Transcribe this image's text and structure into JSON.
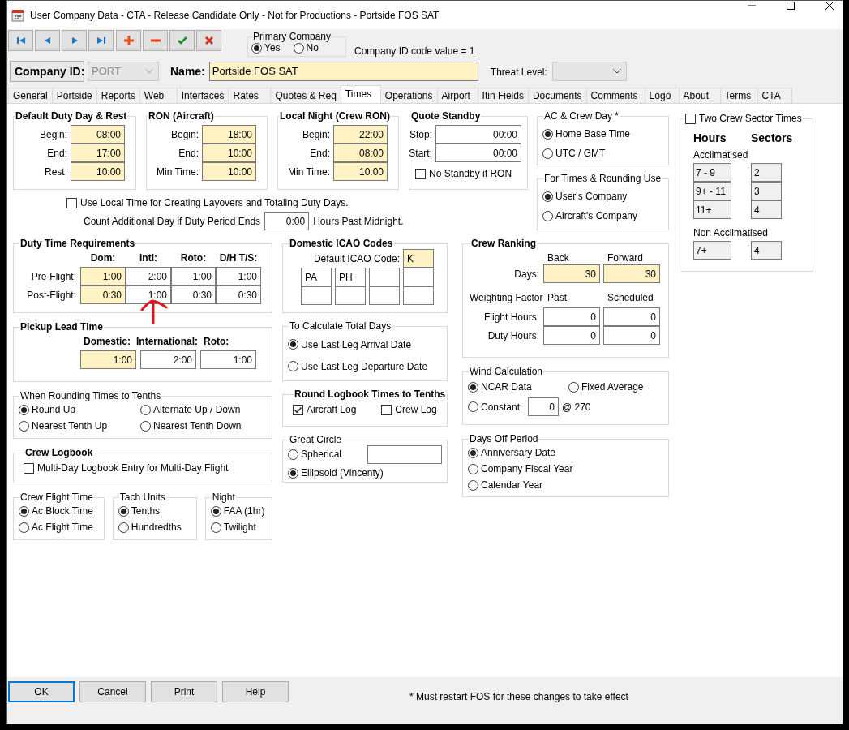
{
  "window": {
    "title": "User Company Data - CTA - Release Candidate Only - Not for Productions - Portside FOS SAT"
  },
  "primary_company": {
    "title": "Primary Company",
    "options": [
      {
        "label": "Yes",
        "selected": true
      },
      {
        "label": "No",
        "selected": false
      }
    ]
  },
  "company_id_code": "Company ID code value = 1",
  "company_id": {
    "label": "Company ID:",
    "value": "PORT",
    "disabled": true
  },
  "name": {
    "label": "Name:",
    "value": "Portside FOS SAT",
    "highlighted": true
  },
  "threat_level": {
    "label": "Threat Level:"
  },
  "tabs": [
    {
      "label": "General",
      "selected": false
    },
    {
      "label": "Portside",
      "selected": false
    },
    {
      "label": "Reports",
      "selected": false
    },
    {
      "label": "Web",
      "selected": false
    },
    {
      "label": "Interfaces",
      "selected": false
    },
    {
      "label": "Rates",
      "selected": false
    },
    {
      "label": "Quotes & Req",
      "selected": false
    },
    {
      "label": "Times",
      "selected": true
    },
    {
      "label": "Operations",
      "selected": false
    },
    {
      "label": "Airport",
      "selected": false
    },
    {
      "label": "Itin Fields",
      "selected": false
    },
    {
      "label": "Documents",
      "selected": false
    },
    {
      "label": "Comments",
      "selected": false
    },
    {
      "label": "Logo",
      "selected": false
    },
    {
      "label": "About",
      "selected": false
    },
    {
      "label": "Terms",
      "selected": false
    },
    {
      "label": "CTA",
      "selected": false
    }
  ],
  "time_groups": [
    {
      "title": "Default Duty Day & Rest",
      "bold": true,
      "rows": [
        {
          "label": "Begin:",
          "field": {
            "value": "08:00",
            "highlighted": true
          }
        },
        {
          "label": "End:",
          "field": {
            "value": "17:00",
            "highlighted": true
          }
        },
        {
          "label": "Rest:",
          "field": {
            "value": "10:00",
            "highlighted": true
          }
        }
      ]
    },
    {
      "title": "RON (Aircraft)",
      "bold": true,
      "rows": [
        {
          "label": "Begin:",
          "field": {
            "value": "18:00",
            "highlighted": true
          }
        },
        {
          "label": "End:",
          "field": {
            "value": "10:00",
            "highlighted": true
          }
        },
        {
          "label": "Min Time:",
          "field": {
            "value": "10:00",
            "highlighted": true
          }
        }
      ]
    },
    {
      "title": "Local Night (Crew RON)",
      "bold": true,
      "rows": [
        {
          "label": "Begin:",
          "field": {
            "value": "22:00",
            "highlighted": true
          }
        },
        {
          "label": "End:",
          "field": {
            "value": "08:00",
            "highlighted": true
          }
        },
        {
          "label": "Min Time:",
          "field": {
            "value": "10:00",
            "highlighted": true
          }
        }
      ]
    },
    {
      "title": "Quote Standby",
      "bold": true,
      "rows": [
        {
          "label": "Stop:",
          "field": {
            "value": "00:00",
            "highlighted": false
          }
        },
        {
          "label": "Start:",
          "field": {
            "value": "00:00",
            "highlighted": false
          }
        }
      ],
      "checkbox": {
        "label": "No Standby if RON",
        "checked": false
      }
    }
  ],
  "ac_crew_day": {
    "title": "AC & Crew Day *",
    "bold": false,
    "options": [
      {
        "label": "Home Base Time",
        "selected": true
      },
      {
        "label": "UTC / GMT",
        "selected": false
      }
    ]
  },
  "times_rounding_use": {
    "title": "For Times & Rounding Use",
    "bold": false,
    "options": [
      {
        "label": "User's Company",
        "selected": true
      },
      {
        "label": "Aircraft's Company",
        "selected": false
      }
    ]
  },
  "use_local_time": {
    "label": "Use Local Time for Creating Layovers and Totaling Duty Days.",
    "checked": false
  },
  "count_additional_day": {
    "label": "Count Additional Day if Duty Period Ends",
    "field": {
      "value": "0:00",
      "highlighted": false
    },
    "suffix": "Hours Past Midnight."
  },
  "duty_time_requirements": {
    "title": "Duty Time Requirements",
    "bold": true,
    "columns": [
      "Dom:",
      "Intl:",
      "Roto:",
      "D/H T/S:"
    ],
    "rows": [
      {
        "label": "Pre-Flight:",
        "cells": [
          {
            "value": "1:00",
            "highlighted": true
          },
          {
            "value": "2:00",
            "highlighted": false
          },
          {
            "value": "1:00",
            "highlighted": false
          },
          {
            "value": "1:00",
            "highlighted": false
          }
        ]
      },
      {
        "label": "Post-Flight:",
        "cells": [
          {
            "value": "0:30",
            "highlighted": true
          },
          {
            "value": "1:00",
            "highlighted": false
          },
          {
            "value": "0:30",
            "highlighted": false
          },
          {
            "value": "0:30",
            "highlighted": false
          }
        ]
      }
    ]
  },
  "domestic_icao_codes": {
    "title": "Domestic ICAO Codes",
    "bold": true,
    "default_label": "Default ICAO Code:",
    "default_field": {
      "value": "K",
      "highlighted": true
    },
    "codes": [
      [
        {
          "value": "PA",
          "highlighted": false
        },
        {
          "value": "PH",
          "highlighted": false
        },
        {
          "highlighted": false
        },
        {
          "highlighted": false
        }
      ],
      [
        {
          "highlighted": false
        },
        {
          "highlighted": false
        },
        {
          "highlighted": false
        },
        {
          "highlighted": false
        }
      ]
    ]
  },
  "pickup_lead_time": {
    "title": "Pickup Lead Time",
    "bold": true,
    "columns": [
      "Domestic:",
      "International:",
      "Roto:"
    ],
    "fields": [
      {
        "value": "1:00",
        "highlighted": true
      },
      {
        "value": "2:00",
        "highlighted": false
      },
      {
        "value": "1:00",
        "highlighted": false
      }
    ]
  },
  "to_calculate_total_days": {
    "title": "To Calculate Total Days",
    "bold": false,
    "options": [
      {
        "label": "Use Last Leg Arrival Date",
        "selected": true
      },
      {
        "label": "Use Last Leg Departure Date",
        "selected": false
      }
    ]
  },
  "rounding_times": {
    "title": "When Rounding Times to Tenths",
    "bold": false,
    "options": [
      {
        "label": "Round Up",
        "selected": true
      },
      {
        "label": "Alternate Up / Down",
        "selected": false
      },
      {
        "label": "Nearest Tenth Up",
        "selected": false
      },
      {
        "label": "Nearest Tenth Down",
        "selected": false
      }
    ]
  },
  "round_logbook_times": {
    "title": "Round Logbook Times to Tenths",
    "bold": true,
    "checkboxes": [
      {
        "label": "Aircraft Log",
        "checked": true
      },
      {
        "label": "Crew Log",
        "checked": false
      }
    ]
  },
  "crew_logbook": {
    "title": "Crew Logbook",
    "bold": true,
    "checkbox": {
      "label": "Multi-Day Logbook Entry for Multi-Day Flight",
      "checked": false
    }
  },
  "great_circle": {
    "title": "Great Circle",
    "bold": false,
    "options": [
      {
        "label": "Spherical",
        "selected": false
      },
      {
        "label": "Ellipsoid (Vincenty)",
        "selected": true
      }
    ],
    "field": {
      "highlighted": false
    }
  },
  "small_groups": [
    {
      "title": "Crew Flight Time",
      "bold": false,
      "options": [
        {
          "label": "Ac Block Time",
          "selected": true
        },
        {
          "label": "Ac Flight Time",
          "selected": false
        }
      ]
    },
    {
      "title": "Tach Units",
      "bold": false,
      "options": [
        {
          "label": "Tenths",
          "selected": true
        },
        {
          "label": "Hundredths",
          "selected": false
        }
      ]
    },
    {
      "title": "Night",
      "bold": false,
      "options": [
        {
          "label": "FAA (1hr)",
          "selected": true
        },
        {
          "label": "Twilight",
          "selected": false
        }
      ]
    }
  ],
  "crew_ranking": {
    "title": "Crew Ranking",
    "bold": true,
    "columns": [
      "Back",
      "Forward"
    ],
    "days": {
      "label": "Days:",
      "fields": [
        {
          "value": "30",
          "highlighted": true
        },
        {
          "value": "30",
          "highlighted": true
        }
      ]
    },
    "weighting_label": "Weighting Factor",
    "weighting_columns": [
      "Past",
      "Scheduled"
    ],
    "rows": [
      {
        "label": "Flight Hours:",
        "fields": [
          {
            "value": "0",
            "highlighted": false
          },
          {
            "value": "0",
            "highlighted": false
          }
        ]
      },
      {
        "label": "Duty Hours:",
        "fields": [
          {
            "value": "0",
            "highlighted": false
          },
          {
            "value": "0",
            "highlighted": false
          }
        ]
      }
    ]
  },
  "wind_calculation": {
    "title": "Wind Calculation",
    "bold": false,
    "options": [
      {
        "label": "NCAR Data",
        "selected": true
      },
      {
        "label": "Fixed Average",
        "selected": false
      },
      {
        "label": "Constant",
        "selected": false
      }
    ],
    "constant_field": {
      "value": "0",
      "highlighted": false
    },
    "constant_suffix": "@ 270"
  },
  "days_off_period": {
    "title": "Days Off Period",
    "bold": false,
    "options": [
      {
        "label": "Anniversary Date",
        "selected": true
      },
      {
        "label": "Company Fiscal Year",
        "selected": false
      },
      {
        "label": "Calendar Year",
        "selected": false
      }
    ]
  },
  "two_crew_sector_times": {
    "checkbox": {
      "label": "Two Crew Sector Times",
      "checked": false
    },
    "hours_heading": "Hours",
    "sectors_heading": "Sectors",
    "groups": [
      {
        "label": "Acclimatised",
        "rows": [
          {
            "hours": "7 - 9",
            "sectors": "2"
          },
          {
            "hours": "9+ - 11",
            "sectors": "3"
          },
          {
            "hours": "11+",
            "sectors": "4"
          }
        ]
      },
      {
        "label": "Non Acclimatised",
        "rows": [
          {
            "hours": "7+",
            "sectors": "4"
          }
        ]
      }
    ]
  },
  "buttons": [
    {
      "label": "OK",
      "default": true
    },
    {
      "label": "Cancel",
      "default": false
    },
    {
      "label": "Print",
      "default": false
    },
    {
      "label": "Help",
      "default": false
    }
  ],
  "footer_note": "* Must restart FOS for these changes to take effect"
}
